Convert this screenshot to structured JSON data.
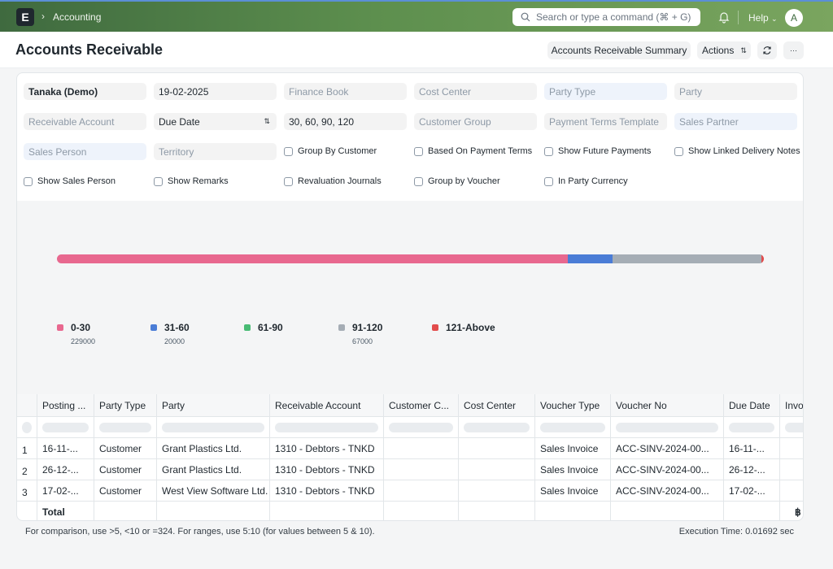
{
  "navbar": {
    "logo_letter": "E",
    "breadcrumb": "Accounting",
    "search_placeholder": "Search or type a command (⌘ + G)",
    "help_label": "Help",
    "avatar_letter": "A"
  },
  "page": {
    "title": "Accounts Receivable",
    "summary_button": "Accounts Receivable Summary",
    "actions_button": "Actions",
    "more_button": "···"
  },
  "filters": {
    "company": "Tanaka (Demo)",
    "date": "19-02-2025",
    "finance_book": "Finance Book",
    "cost_center": "Cost Center",
    "party_type": "Party Type",
    "party": "Party",
    "receivable_account": "Receivable Account",
    "ageing_based_on": "Due Date",
    "range": "30, 60, 90, 120",
    "customer_group": "Customer Group",
    "payment_terms_template": "Payment Terms Template",
    "sales_partner": "Sales Partner",
    "sales_person": "Sales Person",
    "territory": "Territory"
  },
  "checkboxes": {
    "group_by_customer": "Group By Customer",
    "based_on_payment_terms": "Based On Payment Terms",
    "show_future_payments": "Show Future Payments",
    "show_linked_delivery_notes": "Show Linked Delivery Notes",
    "show_sales_person": "Show Sales Person",
    "show_remarks": "Show Remarks",
    "revaluation_journals": "Revaluation Journals",
    "group_by_voucher": "Group by Voucher",
    "in_party_currency": "In Party Currency"
  },
  "chart_data": {
    "type": "bar",
    "categories": [
      "0-30",
      "31-60",
      "61-90",
      "91-120",
      "121-Above"
    ],
    "values": [
      229000,
      20000,
      0,
      67000,
      1000
    ],
    "legend_values": [
      "229000",
      "20000",
      "",
      "67000",
      ""
    ],
    "colors": [
      "#e8688f",
      "#4a7cd6",
      "#48bb74",
      "#a5adb5",
      "#e24c4c"
    ],
    "stacked": true,
    "legend_position": "bottom-left"
  },
  "table": {
    "columns": [
      "Posting ...",
      "Party Type",
      "Party",
      "Receivable Account",
      "Customer C...",
      "Cost Center",
      "Voucher Type",
      "Voucher No",
      "Due Date",
      "Invo"
    ],
    "rows": [
      {
        "idx": "1",
        "cells": [
          "16-11-...",
          "Customer",
          "Grant Plastics Ltd.",
          "1310 - Debtors - TNKD",
          "",
          "",
          "Sales Invoice",
          "ACC-SINV-2024-00...",
          "16-11-...",
          "฿"
        ]
      },
      {
        "idx": "2",
        "cells": [
          "26-12-...",
          "Customer",
          "Grant Plastics Ltd.",
          "1310 - Debtors - TNKD",
          "",
          "",
          "Sales Invoice",
          "ACC-SINV-2024-00...",
          "26-12-...",
          "฿"
        ]
      },
      {
        "idx": "3",
        "cells": [
          "17-02-...",
          "Customer",
          "West View Software Ltd.",
          "1310 - Debtors - TNKD",
          "",
          "",
          "Sales Invoice",
          "ACC-SINV-2024-00...",
          "17-02-...",
          "฿"
        ]
      }
    ],
    "total_label": "Total",
    "total_currency": "฿"
  },
  "footer": {
    "hint": "For comparison, use >5, <10 or =324. For ranges, use 5:10 (for values between 5 & 10).",
    "execution_time": "Execution Time: 0.01692 sec"
  }
}
